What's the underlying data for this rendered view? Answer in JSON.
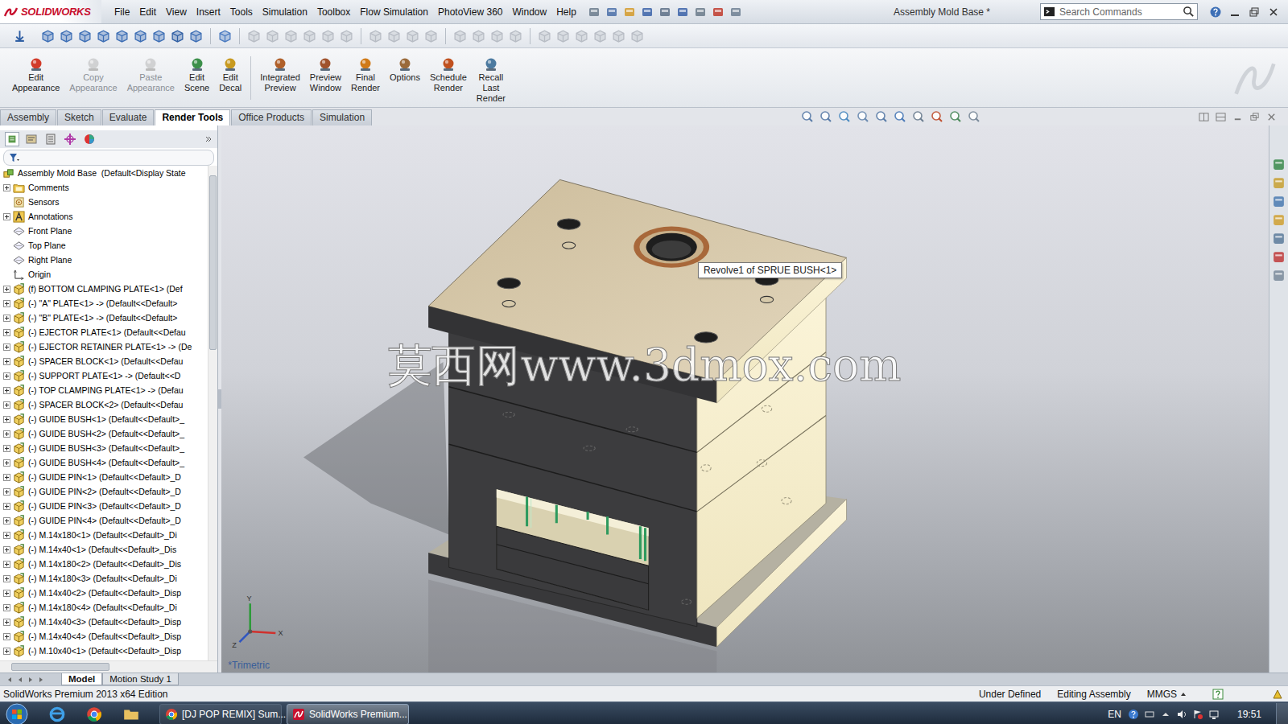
{
  "app": {
    "logo_text": "SOLIDWORKS",
    "document_title": "Assembly Mold Base *"
  },
  "menu": [
    "File",
    "Edit",
    "View",
    "Insert",
    "Tools",
    "Simulation",
    "Toolbox",
    "Flow Simulation",
    "PhotoView 360",
    "Window",
    "Help"
  ],
  "search": {
    "placeholder": "Search Commands"
  },
  "ribbon_groups": [
    [
      {
        "label": "Edit Appearance",
        "disabled": false
      },
      {
        "label": "Copy Appearance",
        "disabled": true
      },
      {
        "label": "Paste Appearance",
        "disabled": true
      },
      {
        "label": "Edit Scene",
        "disabled": false
      },
      {
        "label": "Edit Decal",
        "disabled": false
      }
    ],
    [
      {
        "label": "Integrated Preview",
        "disabled": false
      },
      {
        "label": "Preview Window",
        "disabled": false
      },
      {
        "label": "Final Render",
        "disabled": false
      },
      {
        "label": "Options",
        "disabled": false
      },
      {
        "label": "Schedule Render",
        "disabled": false
      },
      {
        "label": "Recall Last Render",
        "disabled": false
      }
    ]
  ],
  "command_tabs": [
    {
      "label": "Assembly",
      "selected": false
    },
    {
      "label": "Sketch",
      "selected": false
    },
    {
      "label": "Evaluate",
      "selected": false
    },
    {
      "label": "Render Tools",
      "selected": true
    },
    {
      "label": "Office Products",
      "selected": false
    },
    {
      "label": "Simulation",
      "selected": false
    }
  ],
  "feature_tree": {
    "root": {
      "label": "Assembly Mold Base  (Default<Display State",
      "kind": "assembly"
    },
    "items": [
      {
        "label": "Comments",
        "kind": "folder",
        "expandable": true,
        "expanded": false
      },
      {
        "label": "Sensors",
        "kind": "sensor",
        "expandable": false,
        "expanded": false
      },
      {
        "label": "Annotations",
        "kind": "annotation",
        "expandable": true,
        "expanded": false
      },
      {
        "label": "Front Plane",
        "kind": "plane",
        "expandable": false,
        "expanded": false
      },
      {
        "label": "Top Plane",
        "kind": "plane",
        "expandable": false,
        "expanded": false
      },
      {
        "label": "Right Plane",
        "kind": "plane",
        "expandable": false,
        "expanded": false
      },
      {
        "label": "Origin",
        "kind": "origin",
        "expandable": false,
        "expanded": false
      },
      {
        "label": "(f) BOTTOM CLAMPING PLATE<1> (Def",
        "kind": "part",
        "expandable": true,
        "expanded": false
      },
      {
        "label": "(-) \"A\" PLATE<1> -> (Default<<Default>",
        "kind": "part",
        "expandable": true,
        "expanded": false
      },
      {
        "label": "(-) \"B\" PLATE<1> -> (Default<<Default>",
        "kind": "part",
        "expandable": true,
        "expanded": false
      },
      {
        "label": "(-) EJECTOR PLATE<1> (Default<<Defau",
        "kind": "part",
        "expandable": true,
        "expanded": false
      },
      {
        "label": "(-) EJECTOR RETAINER PLATE<1> -> (De",
        "kind": "part",
        "expandable": true,
        "expanded": false
      },
      {
        "label": "(-) SPACER BLOCK<1> (Default<<Defau",
        "kind": "part",
        "expandable": true,
        "expanded": false
      },
      {
        "label": "(-) SUPPORT PLATE<1> -> (Default<<D",
        "kind": "part",
        "expandable": true,
        "expanded": false
      },
      {
        "label": "(-) TOP CLAMPING PLATE<1> -> (Defau",
        "kind": "part",
        "expandable": true,
        "expanded": false
      },
      {
        "label": "(-) SPACER BLOCK<2> (Default<<Defau",
        "kind": "part",
        "expandable": true,
        "expanded": false
      },
      {
        "label": "(-) GUIDE BUSH<1> (Default<<Default>_",
        "kind": "part",
        "expandable": true,
        "expanded": false
      },
      {
        "label": "(-) GUIDE BUSH<2> (Default<<Default>_",
        "kind": "part",
        "expandable": true,
        "expanded": false
      },
      {
        "label": "(-) GUIDE BUSH<3> (Default<<Default>_",
        "kind": "part",
        "expandable": true,
        "expanded": false
      },
      {
        "label": "(-) GUIDE BUSH<4> (Default<<Default>_",
        "kind": "part",
        "expandable": true,
        "expanded": false
      },
      {
        "label": "(-) GUIDE PIN<1> (Default<<Default>_D",
        "kind": "part",
        "expandable": true,
        "expanded": false
      },
      {
        "label": "(-) GUIDE PIN<2> (Default<<Default>_D",
        "kind": "part",
        "expandable": true,
        "expanded": false
      },
      {
        "label": "(-) GUIDE PIN<3> (Default<<Default>_D",
        "kind": "part",
        "expandable": true,
        "expanded": false
      },
      {
        "label": "(-) GUIDE PIN<4> (Default<<Default>_D",
        "kind": "part",
        "expandable": true,
        "expanded": false
      },
      {
        "label": "(-) M.14x180<1> (Default<<Default>_Di",
        "kind": "part",
        "expandable": true,
        "expanded": false
      },
      {
        "label": "(-) M.14x40<1> (Default<<Default>_Dis",
        "kind": "part",
        "expandable": true,
        "expanded": false
      },
      {
        "label": "(-) M.14x180<2> (Default<<Default>_Dis",
        "kind": "part",
        "expandable": true,
        "expanded": false
      },
      {
        "label": "(-) M.14x180<3> (Default<<Default>_Di",
        "kind": "part",
        "expandable": true,
        "expanded": false
      },
      {
        "label": "(-) M.14x40<2> (Default<<Default>_Disp",
        "kind": "part",
        "expandable": true,
        "expanded": false
      },
      {
        "label": "(-) M.14x180<4> (Default<<Default>_Di",
        "kind": "part",
        "expandable": true,
        "expanded": false
      },
      {
        "label": "(-) M.14x40<3> (Default<<Default>_Disp",
        "kind": "part",
        "expandable": true,
        "expanded": false
      },
      {
        "label": "(-) M.14x40<4> (Default<<Default>_Disp",
        "kind": "part",
        "expandable": true,
        "expanded": false
      },
      {
        "label": "(-) M.10x40<1> (Default<<Default>_Disp",
        "kind": "part",
        "expandable": true,
        "expanded": false
      }
    ]
  },
  "viewport": {
    "watermark": "莫西网www.3dmox.com",
    "tooltip": "Revolve1 of SPRUE BUSH<1>",
    "view_name": "*Trimetric",
    "axes": {
      "x": "X",
      "y": "Y",
      "z": "Z"
    }
  },
  "model_tabs": [
    {
      "label": "Model",
      "selected": true
    },
    {
      "label": "Motion Study 1",
      "selected": false
    }
  ],
  "status_bar": {
    "edition": "SolidWorks Premium 2013 x64 Edition",
    "items": [
      "Under Defined",
      "Editing Assembly",
      "MMGS"
    ]
  },
  "taskbar": {
    "tasks": [
      {
        "label": "[DJ POP REMIX] Sum...",
        "kind": "browser",
        "selected": false
      },
      {
        "label": "SolidWorks Premium...",
        "kind": "solidworks",
        "selected": true
      }
    ],
    "language": "EN",
    "time": "19:51"
  }
}
